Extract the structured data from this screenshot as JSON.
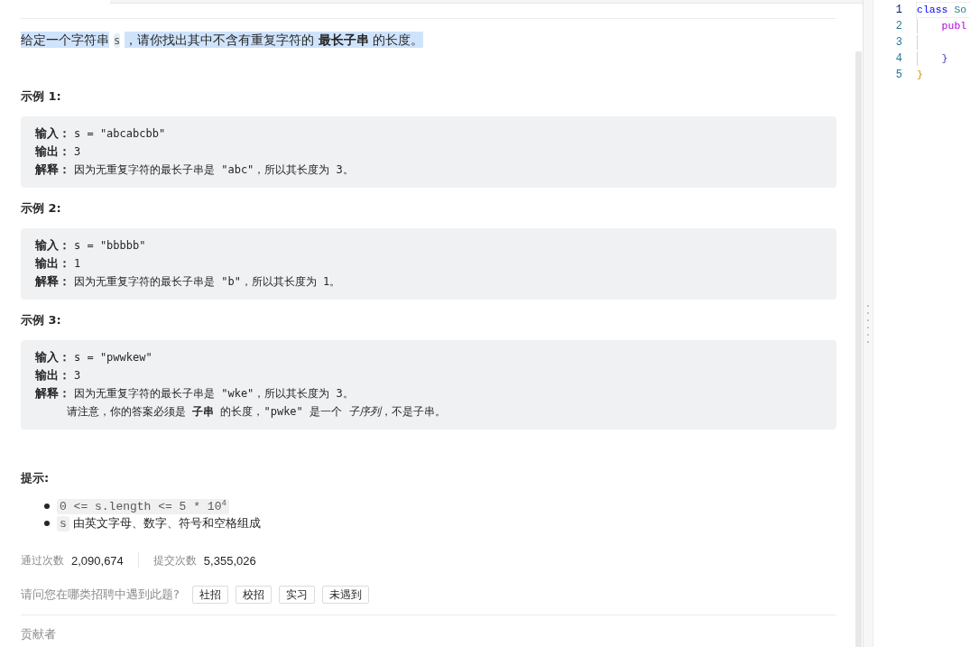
{
  "description": {
    "selected": true,
    "parts": [
      {
        "kind": "text",
        "text": "给定一个字符串"
      },
      {
        "kind": "code",
        "text": "s"
      },
      {
        "kind": "text",
        "text": "，请你找出其中不含有重复字符的 **最长子串** 的长度。"
      }
    ]
  },
  "examples": [
    {
      "title": "示例 1:",
      "lines": [
        {
          "kind": "field",
          "label": "输入：",
          "value": "s = \"abcabcbb\""
        },
        {
          "kind": "field",
          "label": "输出：",
          "value": "3"
        },
        {
          "kind": "field",
          "label": "解释：",
          "value": "因为无重复字符的最长子串是 \"abc\"，所以其长度为 3。"
        }
      ]
    },
    {
      "title": "示例 2:",
      "lines": [
        {
          "kind": "field",
          "label": "输入：",
          "value": "s = \"bbbbb\""
        },
        {
          "kind": "field",
          "label": "输出：",
          "value": "1"
        },
        {
          "kind": "field",
          "label": "解释：",
          "value": "因为无重复字符的最长子串是 \"b\"，所以其长度为 1。"
        }
      ]
    },
    {
      "title": "示例 3:",
      "lines": [
        {
          "kind": "field",
          "label": "输入：",
          "value": "s = \"pwwkew\""
        },
        {
          "kind": "field",
          "label": "输出：",
          "value": "3"
        },
        {
          "kind": "field",
          "label": "解释：",
          "value": "因为无重复字符的最长子串是 \"wke\"，所以其长度为 3。"
        },
        {
          "kind": "note",
          "value": "请注意，你的答案必须是 **子串** 的长度，\"pwke\" 是一个 *子序列*，不是子串。"
        }
      ]
    }
  ],
  "hints": {
    "title": "提示:",
    "items": [
      {
        "parts": [
          {
            "kind": "code",
            "text": "0 <= s.length <= 5 * 10$^{4}$"
          }
        ]
      },
      {
        "parts": [
          {
            "kind": "code",
            "text": "s"
          },
          {
            "kind": "text",
            "text": "由英文字母、数字、符号和空格组成"
          }
        ]
      }
    ]
  },
  "stats": [
    {
      "label": "通过次数",
      "value": "2,090,674"
    },
    {
      "label": "提交次数",
      "value": "5,355,026"
    }
  ],
  "survey": {
    "question": "请问您在哪类招聘中遇到此题?",
    "options": [
      "社招",
      "校招",
      "实习",
      "未遇到"
    ]
  },
  "contributors": {
    "title": "贡献者"
  },
  "editor": {
    "lines": [
      {
        "number": "1",
        "active": true,
        "indent_guide": false,
        "tokens": [
          {
            "kind": "keyword",
            "text": "class"
          },
          {
            "kind": "type",
            "text": " So"
          }
        ]
      },
      {
        "number": "2",
        "active": false,
        "indent_guide": true,
        "tokens": [
          {
            "kind": "modifier",
            "text": "    publ"
          }
        ]
      },
      {
        "number": "3",
        "active": false,
        "indent_guide": true
      },
      {
        "number": "4",
        "active": false,
        "indent_guide": true,
        "tokens": [
          {
            "kind": "innerbrace",
            "text": "    }"
          }
        ]
      },
      {
        "number": "5",
        "active": false,
        "indent_guide": false,
        "tokens": [
          {
            "kind": "outerbrace",
            "text": "}"
          }
        ]
      }
    ]
  }
}
